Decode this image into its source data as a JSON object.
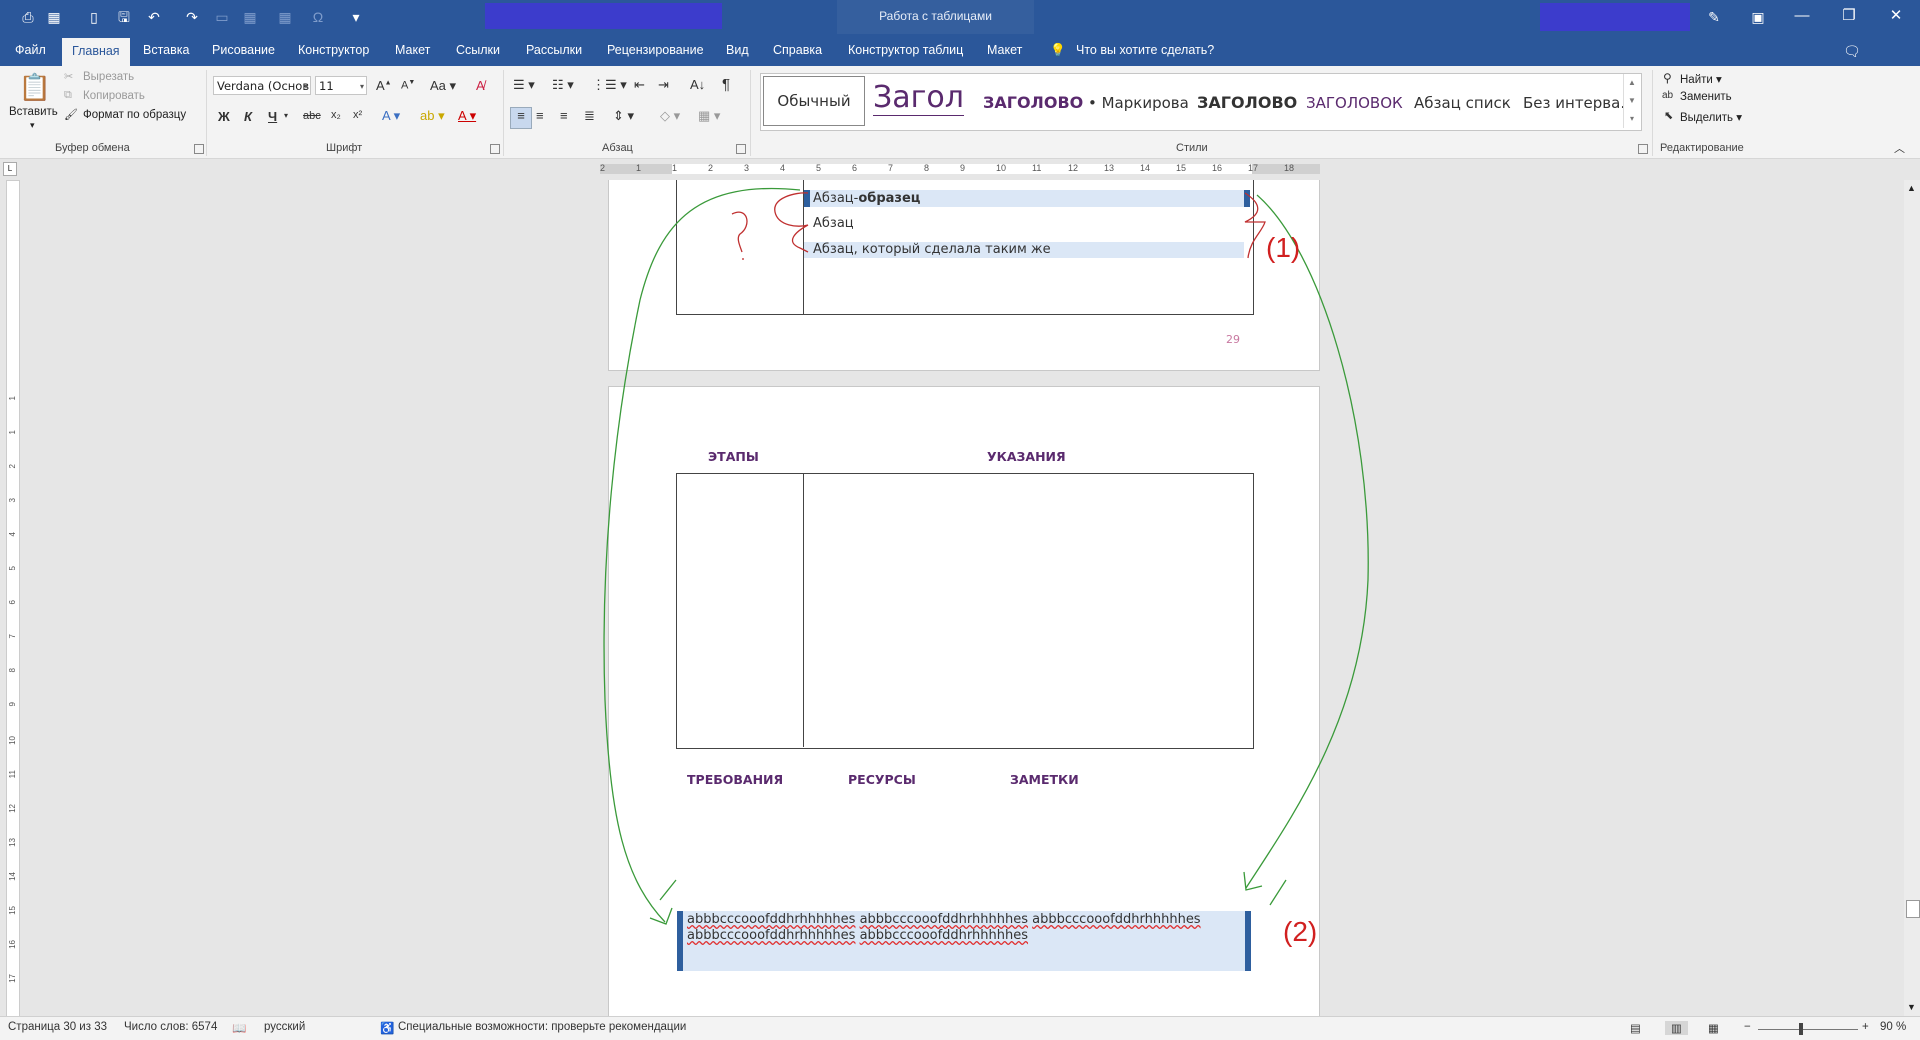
{
  "titlebar": {
    "context_group": "Работа с таблицами",
    "window_controls": [
      "minimize-icon",
      "restore-icon",
      "close-icon"
    ]
  },
  "tabs": [
    "Файл",
    "Главная",
    "Вставка",
    "Рисование",
    "Конструктор",
    "Макет",
    "Ссылки",
    "Рассылки",
    "Рецензирование",
    "Вид",
    "Справка",
    "Конструктор таблиц",
    "Макет"
  ],
  "tell_me": "Что вы хотите сделать?",
  "clipboard": {
    "paste": "Вставить",
    "cut": "Вырезать",
    "copy": "Копировать",
    "format_painter": "Формат по образцу",
    "group": "Буфер обмена"
  },
  "font": {
    "name": "Verdana (Основ",
    "size": "11",
    "bold": "Ж",
    "italic": "К",
    "underline": "Ч",
    "strikethrough": "abc",
    "subscript": "x₂",
    "superscript": "x²",
    "change_case": "Aa",
    "group": "Шрифт"
  },
  "paragraph": {
    "group": "Абзац"
  },
  "styles": {
    "items": [
      "Обычный",
      "Загол",
      "ЗАГОЛОВО",
      "• Маркирова",
      "ЗАГОЛОВО",
      "ЗАГОЛОВОК",
      "Абзац списк",
      "Без интерва."
    ],
    "group": "Стили"
  },
  "editing": {
    "find": "Найти",
    "replace": "Заменить",
    "select": "Выделить",
    "group": "Редактирование"
  },
  "ruler_numbers": [
    "2",
    "1",
    "1",
    "2",
    "3",
    "4",
    "5",
    "6",
    "7",
    "8",
    "9",
    "10",
    "11",
    "12",
    "13",
    "14",
    "15",
    "16",
    "17",
    "18"
  ],
  "vruler_numbers": [
    "1",
    "1",
    "2",
    "3",
    "4",
    "5",
    "6",
    "7",
    "8",
    "9",
    "10",
    "11",
    "12",
    "13",
    "14",
    "15",
    "16",
    "17"
  ],
  "page1": {
    "line1_normal": "Абзац-",
    "line1_bold": "образец",
    "line2": "Абзац",
    "line3": "Абзац, который сделала таким же",
    "page_number": "29",
    "annotation": "(1)",
    "question_mark": "?"
  },
  "page2": {
    "col1": "ЭТАПЫ",
    "col2": "УКАЗАНИЯ",
    "footer_labels": [
      "ТРЕБОВАНИЯ",
      "РЕСУРСЫ",
      "ЗАМЕТКИ"
    ],
    "text_line1": [
      "abbbcccooofddhrhhhhhes",
      "abbbcccooofddhrhhhhhes",
      "abbbcccooofddhrhhhhhes"
    ],
    "text_line2": [
      "abbbcccooofddhrhhhhhes",
      "abbbcccooofddhrhhhhhes"
    ],
    "annotation": "(2)"
  },
  "status": {
    "page": "Страница 30 из 33",
    "words": "Число слов: 6574",
    "language": "русский",
    "accessibility": "Специальные возможности: проверьте рекомендации",
    "zoom": "90 %"
  },
  "colors": {
    "ribbon_blue": "#2b579a",
    "heading_purple": "#5a2a6e",
    "annotation_red": "#d12020",
    "annotation_green": "#3a9a3a",
    "selection": "#dbe7f6"
  }
}
